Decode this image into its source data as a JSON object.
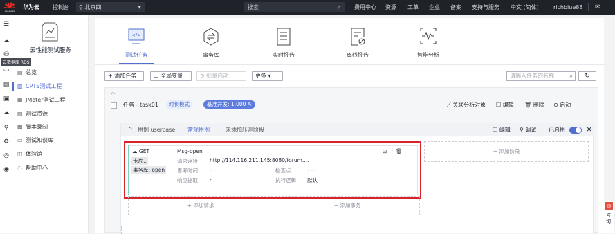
{
  "topbar": {
    "logo_text": "HUAWEI",
    "brand": "华为云",
    "console": "控制台",
    "region": "北京四",
    "search_placeholder": "搜索",
    "links": [
      "费用中心",
      "资源",
      "工单",
      "企业",
      "备案",
      "支持与服务",
      "中文 (简体)",
      "richblue88"
    ]
  },
  "sidebar": {
    "service_title": "云性能测试服务",
    "tooltip": "云数据库 RDS",
    "items": [
      {
        "label": "总览",
        "icon": "grid-icon"
      },
      {
        "label": "CPTS测试工程",
        "icon": "project-icon"
      },
      {
        "label": "JMeter测试工程",
        "icon": "jmeter-icon"
      },
      {
        "label": "测试资源",
        "icon": "resource-icon"
      },
      {
        "label": "脚本录制",
        "icon": "record-icon"
      },
      {
        "label": "测试知识库",
        "icon": "knowledge-icon"
      },
      {
        "label": "体验馆",
        "icon": "experience-icon"
      },
      {
        "label": "帮助中心",
        "icon": "help-icon"
      }
    ]
  },
  "tabs": [
    {
      "label": "测试任务",
      "icon": "code-icon",
      "active": true
    },
    {
      "label": "事务库",
      "icon": "transaction-icon"
    },
    {
      "label": "实时报告",
      "icon": "report-icon"
    },
    {
      "label": "离线报告",
      "icon": "offline-report-icon"
    },
    {
      "label": "智能分析",
      "icon": "analysis-icon"
    }
  ],
  "toolbar": {
    "add_task": "+ 添加任务",
    "global_var": "全局变量",
    "batch_start": "批量启动",
    "more": "更多"
  },
  "filter": {
    "placeholder": "请输入任务的名称"
  },
  "task": {
    "name": "任务 - task01",
    "mode_tag": "时长模式",
    "concurrency_tag": "基准并发: 1,000",
    "actions": {
      "link": "关联分析对象",
      "edit": "编辑",
      "delete": "删除",
      "start": "启动"
    }
  },
  "usecase": {
    "title": "用例 usercase",
    "tab_normal": "常规用例",
    "tab_stress": "未添加压测阶段",
    "edit": "编辑",
    "debug": "调试",
    "enabled": "已启用",
    "close": "×"
  },
  "request": {
    "method": "GET",
    "name": "Msg-open",
    "chip": "卡片1",
    "lib": "事务库: open",
    "url_label": "请求连接",
    "url": "http://114.116.211.145:8080/forum....",
    "think_label": "思考时间",
    "think": "-",
    "check_label": "检查点",
    "check": "- - -",
    "resp_label": "响应提取",
    "resp": "-",
    "exec_label": "执行逻辑",
    "exec": "默认"
  },
  "actions": {
    "add_stage": "+ 添加阶段",
    "add_request": "+ 添加请求",
    "add_transaction": "+ 添加事务"
  },
  "float_widget": {
    "text": "咨询"
  }
}
